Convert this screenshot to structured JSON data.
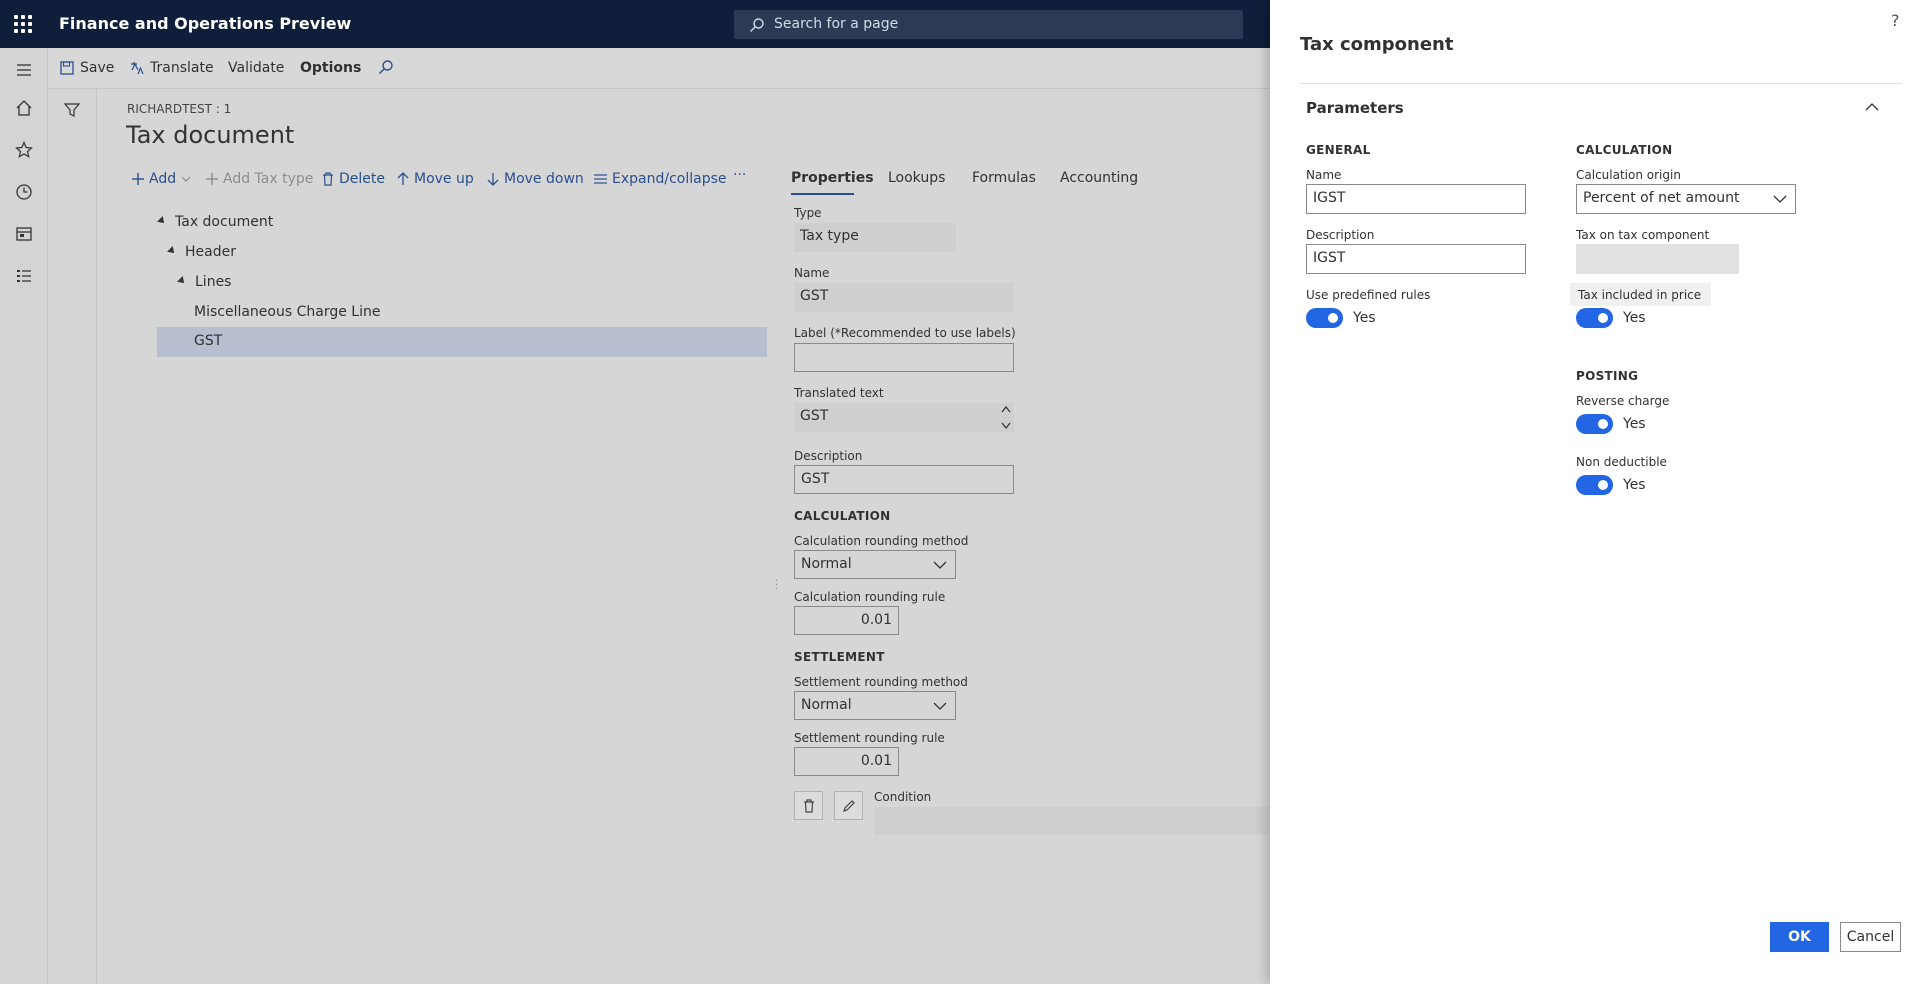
{
  "app": {
    "title": "Finance and Operations Preview"
  },
  "search": {
    "placeholder": "Search for a page"
  },
  "actionbar": {
    "save": "Save",
    "translate": "Translate",
    "validate": "Validate",
    "options": "Options"
  },
  "main": {
    "breadcrumb": "RICHARDTEST : 1",
    "title": "Tax document",
    "toolbar": {
      "add": "Add",
      "add_tax_type": "Add Tax type",
      "delete": "Delete",
      "move_up": "Move up",
      "move_down": "Move down",
      "expand_collapse": "Expand/collapse",
      "more": "···"
    },
    "tree": [
      {
        "label": "Tax document"
      },
      {
        "label": "Header"
      },
      {
        "label": "Lines"
      },
      {
        "label": "Miscellaneous Charge Line"
      },
      {
        "label": "GST"
      }
    ]
  },
  "properties": {
    "tabs": [
      "Properties",
      "Lookups",
      "Formulas",
      "Accounting"
    ],
    "type_label": "Type",
    "type_value": "Tax type",
    "name_label": "Name",
    "name_value": "GST",
    "label_label": "Label (*Recommended to use labels)",
    "label_value": "",
    "translated_label": "Translated text",
    "translated_value": "GST",
    "description_label": "Description",
    "description_value": "GST",
    "calc_section": "CALCULATION",
    "calc_method_label": "Calculation rounding method",
    "calc_method_value": "Normal",
    "calc_rule_label": "Calculation rounding rule",
    "calc_rule_value": "0.01",
    "settle_section": "SETTLEMENT",
    "settle_method_label": "Settlement rounding method",
    "settle_method_value": "Normal",
    "settle_rule_label": "Settlement rounding rule",
    "settle_rule_value": "0.01",
    "condition_label": "Condition"
  },
  "dialog": {
    "help": "?",
    "title": "Tax component",
    "section": "Parameters",
    "general": "GENERAL",
    "calculation": "CALCULATION",
    "posting": "POSTING",
    "name_label": "Name",
    "name_value": "IGST",
    "description_label": "Description",
    "description_value": "IGST",
    "predef_label": "Use predefined rules",
    "predef_value": "Yes",
    "calc_origin_label": "Calculation origin",
    "calc_origin_value": "Percent of net amount",
    "tax_on_tax_label": "Tax on tax component",
    "tax_incl_label": "Tax included in price",
    "tax_incl_value": "Yes",
    "reverse_label": "Reverse charge",
    "reverse_value": "Yes",
    "nondeduct_label": "Non deductible",
    "nondeduct_value": "Yes",
    "ok": "OK",
    "cancel": "Cancel"
  },
  "colors": {
    "navy": "#0f1e3a",
    "accent": "#2266e3",
    "link": "#2a4f8f"
  }
}
